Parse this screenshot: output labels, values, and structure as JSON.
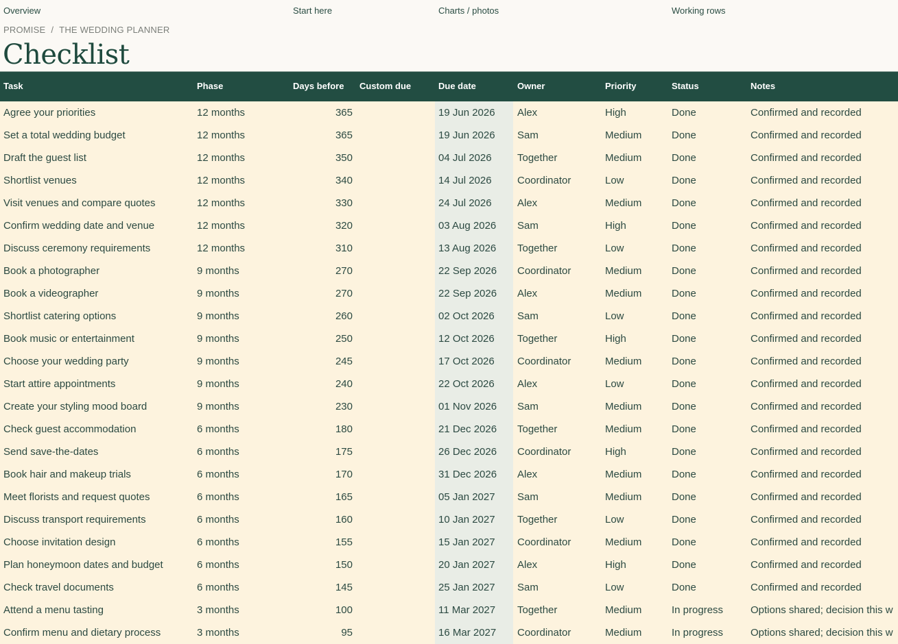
{
  "nav": {
    "items": [
      "Overview",
      "Start here",
      "Charts / photos",
      "Working rows"
    ]
  },
  "breadcrumb": {
    "parent": "PROMISE",
    "separator": "/",
    "current": "THE WEDDING PLANNER"
  },
  "page": {
    "title": "Checklist"
  },
  "colors": {
    "header_bg": "#224d42",
    "row_bg": "#fdf3de",
    "due_col_bg": "#e9ede6",
    "text": "#2c4a42"
  },
  "table": {
    "columns": [
      "Task",
      "Phase",
      "Days before",
      "Custom due",
      "Due date",
      "Owner",
      "Priority",
      "Status",
      "Notes"
    ],
    "rows": [
      [
        "Agree your priorities",
        "12 months",
        "365",
        "",
        "19 Jun 2026",
        "Alex",
        "High",
        "Done",
        "Confirmed and recorded"
      ],
      [
        "Set a total wedding budget",
        "12 months",
        "365",
        "",
        "19 Jun 2026",
        "Sam",
        "Medium",
        "Done",
        "Confirmed and recorded"
      ],
      [
        "Draft the guest list",
        "12 months",
        "350",
        "",
        "04 Jul 2026",
        "Together",
        "Medium",
        "Done",
        "Confirmed and recorded"
      ],
      [
        "Shortlist venues",
        "12 months",
        "340",
        "",
        "14 Jul 2026",
        "Coordinator",
        "Low",
        "Done",
        "Confirmed and recorded"
      ],
      [
        "Visit venues and compare quotes",
        "12 months",
        "330",
        "",
        "24 Jul 2026",
        "Alex",
        "Medium",
        "Done",
        "Confirmed and recorded"
      ],
      [
        "Confirm wedding date and venue",
        "12 months",
        "320",
        "",
        "03 Aug 2026",
        "Sam",
        "High",
        "Done",
        "Confirmed and recorded"
      ],
      [
        "Discuss ceremony requirements",
        "12 months",
        "310",
        "",
        "13 Aug 2026",
        "Together",
        "Low",
        "Done",
        "Confirmed and recorded"
      ],
      [
        "Book a photographer",
        "9 months",
        "270",
        "",
        "22 Sep 2026",
        "Coordinator",
        "Medium",
        "Done",
        "Confirmed and recorded"
      ],
      [
        "Book a videographer",
        "9 months",
        "270",
        "",
        "22 Sep 2026",
        "Alex",
        "Medium",
        "Done",
        "Confirmed and recorded"
      ],
      [
        "Shortlist catering options",
        "9 months",
        "260",
        "",
        "02 Oct 2026",
        "Sam",
        "Low",
        "Done",
        "Confirmed and recorded"
      ],
      [
        "Book music or entertainment",
        "9 months",
        "250",
        "",
        "12 Oct 2026",
        "Together",
        "High",
        "Done",
        "Confirmed and recorded"
      ],
      [
        "Choose your wedding party",
        "9 months",
        "245",
        "",
        "17 Oct 2026",
        "Coordinator",
        "Medium",
        "Done",
        "Confirmed and recorded"
      ],
      [
        "Start attire appointments",
        "9 months",
        "240",
        "",
        "22 Oct 2026",
        "Alex",
        "Low",
        "Done",
        "Confirmed and recorded"
      ],
      [
        "Create your styling mood board",
        "9 months",
        "230",
        "",
        "01 Nov 2026",
        "Sam",
        "Medium",
        "Done",
        "Confirmed and recorded"
      ],
      [
        "Check guest accommodation",
        "6 months",
        "180",
        "",
        "21 Dec 2026",
        "Together",
        "Medium",
        "Done",
        "Confirmed and recorded"
      ],
      [
        "Send save-the-dates",
        "6 months",
        "175",
        "",
        "26 Dec 2026",
        "Coordinator",
        "High",
        "Done",
        "Confirmed and recorded"
      ],
      [
        "Book hair and makeup trials",
        "6 months",
        "170",
        "",
        "31 Dec 2026",
        "Alex",
        "Medium",
        "Done",
        "Confirmed and recorded"
      ],
      [
        "Meet florists and request quotes",
        "6 months",
        "165",
        "",
        "05 Jan 2027",
        "Sam",
        "Medium",
        "Done",
        "Confirmed and recorded"
      ],
      [
        "Discuss transport requirements",
        "6 months",
        "160",
        "",
        "10 Jan 2027",
        "Together",
        "Low",
        "Done",
        "Confirmed and recorded"
      ],
      [
        "Choose invitation design",
        "6 months",
        "155",
        "",
        "15 Jan 2027",
        "Coordinator",
        "Medium",
        "Done",
        "Confirmed and recorded"
      ],
      [
        "Plan honeymoon dates and budget",
        "6 months",
        "150",
        "",
        "20 Jan 2027",
        "Alex",
        "High",
        "Done",
        "Confirmed and recorded"
      ],
      [
        "Check travel documents",
        "6 months",
        "145",
        "",
        "25 Jan 2027",
        "Sam",
        "Low",
        "Done",
        "Confirmed and recorded"
      ],
      [
        "Attend a menu tasting",
        "3 months",
        "100",
        "",
        "11 Mar 2027",
        "Together",
        "Medium",
        "In progress",
        "Options shared; decision this w"
      ],
      [
        "Confirm menu and dietary process",
        "3 months",
        "95",
        "",
        "16 Mar 2027",
        "Coordinator",
        "Medium",
        "In progress",
        "Options shared; decision this w"
      ]
    ]
  }
}
